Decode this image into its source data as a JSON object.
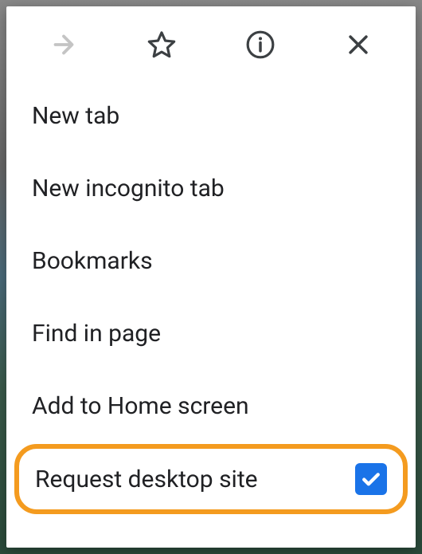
{
  "toolbar": {
    "forward_icon": "forward",
    "bookmark_icon": "star",
    "info_icon": "info",
    "close_icon": "close"
  },
  "menu": {
    "new_tab": "New tab",
    "new_incognito_tab": "New incognito tab",
    "bookmarks": "Bookmarks",
    "find_in_page": "Find in page",
    "add_to_home_screen": "Add to Home screen",
    "request_desktop_site": "Request desktop site",
    "request_desktop_site_checked": true
  },
  "highlight": {
    "color": "#f49b1f"
  }
}
